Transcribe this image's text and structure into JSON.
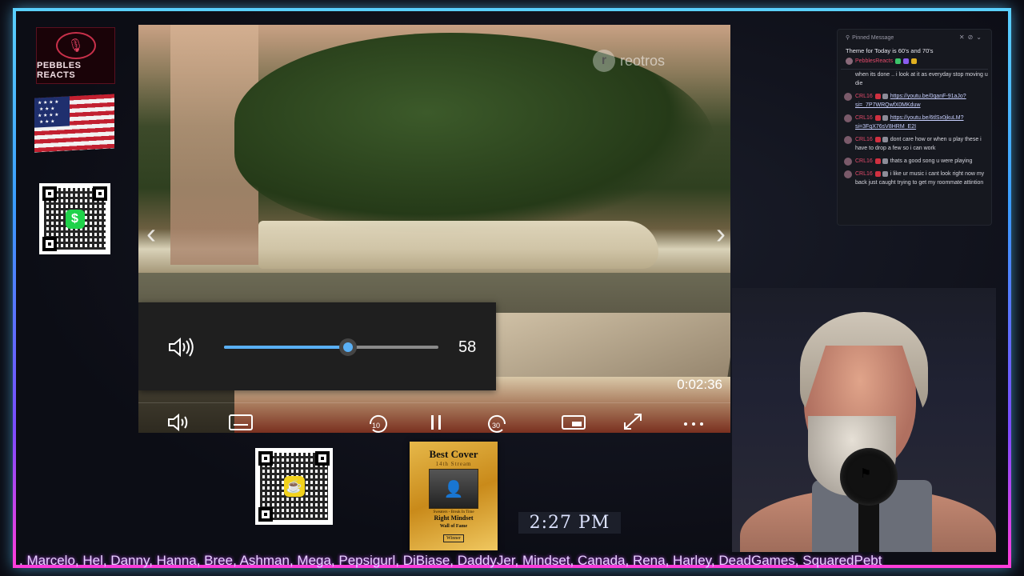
{
  "branding": {
    "logo_text": "PEBBLES REACTS",
    "accent_color": "#5ad0ff",
    "secondary_accent": "#ff3dd9"
  },
  "video_player": {
    "watermark": "reotros",
    "volume_icon": "speaker-high-icon",
    "volume_value": "58",
    "volume_level": 0.58,
    "timestamp": "0:02:36",
    "skip_back_label": "10",
    "skip_forward_label": "30",
    "controls": {
      "volume_icon": "speaker-icon",
      "captions_icon": "captions-icon",
      "rewind_icon": "rewind-10-icon",
      "pause_icon": "pause-icon",
      "forward_icon": "forward-30-icon",
      "miniplayer_icon": "miniplayer-icon",
      "fullscreen_icon": "fullscreen-icon",
      "more_icon": "more-icon"
    }
  },
  "chat": {
    "pinned_header": "Pinned Message",
    "pinned_text": "Theme for Today is 60's and 70's",
    "pinned_user": "PebblesReacts",
    "messages": [
      {
        "user": "",
        "text": "when its done .. i look at it as everyday stop moving u die",
        "link": ""
      },
      {
        "user": "CRL16",
        "text": "",
        "link": "https://youtu.be/0qanF-91aJo?si=_7P7WRQwfX0MKduw"
      },
      {
        "user": "CRL16",
        "text": "",
        "link": "https://youtu.be/6tlSx0jkuLM?si=3FqX76sV8HRM_E2I"
      },
      {
        "user": "CRL16",
        "text": "dont care how or when u play these i have to drop a few so i can work",
        "link": ""
      },
      {
        "user": "CRL16",
        "text": "thats a good song u were playing",
        "link": ""
      },
      {
        "user": "CRL16",
        "text": "i like ur music i cant look right now my back just caught trying to get my roommate attintion",
        "link": ""
      }
    ]
  },
  "award": {
    "title": "Best Cover",
    "subtitle": "14th Stream",
    "caption": "Sweaters - Break In Time",
    "name": "Right Mindset",
    "footer": "Wall of Fame",
    "badge": "Winner"
  },
  "clock": "2:27 PM",
  "ticker": ". Marcelo, Hel, Danny, Hanna, Bree, Ashman, Mega, Pepsigurl, DiBiase, DaddyJer, Mindset, Canada, Rena, Harley, DeadGames, SquaredPebt"
}
